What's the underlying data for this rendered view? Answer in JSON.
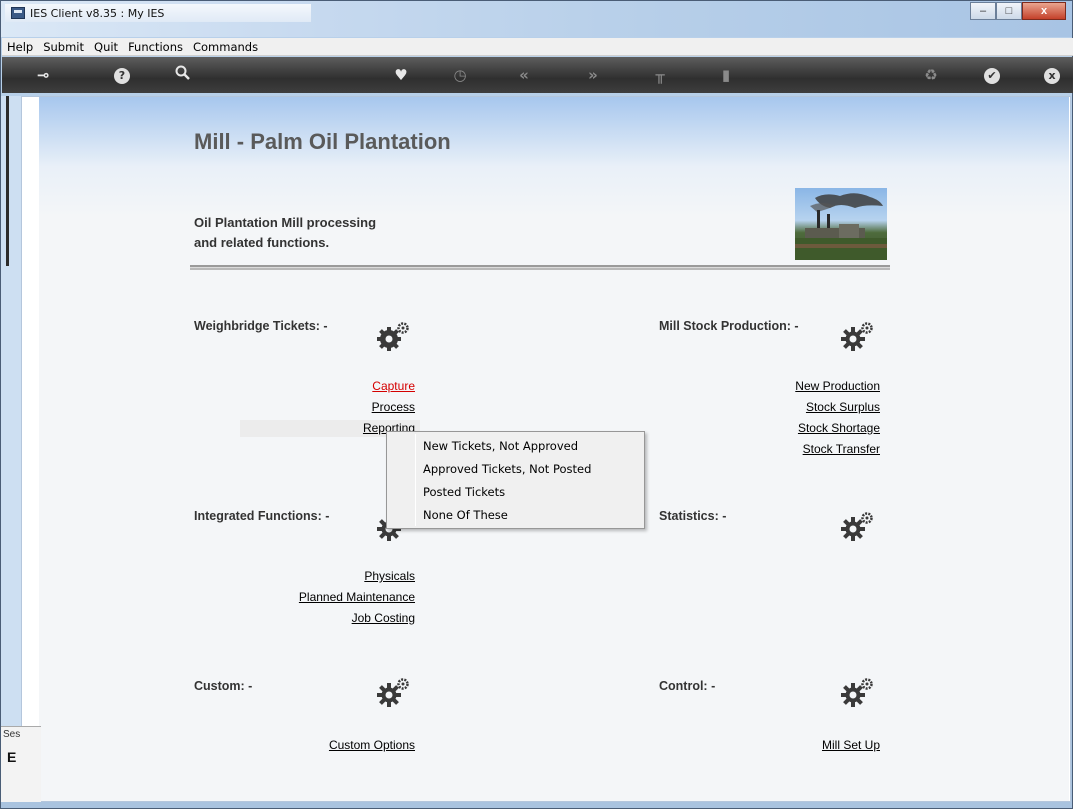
{
  "window": {
    "title": "IES Client v8.35 : My IES",
    "minimize": "–",
    "maximize": "□",
    "close": "x"
  },
  "menu": [
    "Help",
    "Submit",
    "Quit",
    "Functions",
    "Commands"
  ],
  "toolbar": {
    "icons": [
      "key-icon",
      "help-icon",
      "search-icon",
      "heart-icon",
      "clock-icon",
      "back-icon",
      "forward-icon",
      "tools-icon",
      "document-icon",
      "recycle-icon",
      "check-icon",
      "close-icon"
    ],
    "glyphs": {
      "key": "⊸",
      "help": "?",
      "search": "🔍",
      "heart": "♥",
      "clock": "◷",
      "back": "«",
      "forward": "»",
      "tools": "╥",
      "doc": "▮",
      "recycle": "♻",
      "check": "✔",
      "close": "x"
    }
  },
  "page": {
    "title": "Mill - Palm Oil Plantation",
    "subtitle_line1": "Oil Plantation Mill processing",
    "subtitle_line2": "and related functions."
  },
  "sections": {
    "weighbridge": {
      "title": "Weighbridge Tickets: -",
      "links": [
        "Capture",
        "Process",
        "Reporting"
      ]
    },
    "mill_stock": {
      "title": "Mill Stock Production: -",
      "links": [
        "New Production",
        "Stock Surplus",
        "Stock Shortage",
        "Stock Transfer"
      ]
    },
    "integrated": {
      "title": "Integrated Functions: -",
      "links": [
        "Physicals",
        "Planned Maintenance",
        "Job Costing"
      ]
    },
    "statistics": {
      "title": "Statistics: -"
    },
    "custom": {
      "title": "Custom: -",
      "links": [
        "Custom Options"
      ]
    },
    "control": {
      "title": "Control: -",
      "links": [
        "Mill Set Up"
      ]
    }
  },
  "popup_menu": [
    "New Tickets, Not Approved",
    "Approved Tickets, Not Posted",
    "Posted Tickets",
    "None Of These"
  ],
  "side_panel": {
    "label": "Ses",
    "glyph": "E"
  }
}
